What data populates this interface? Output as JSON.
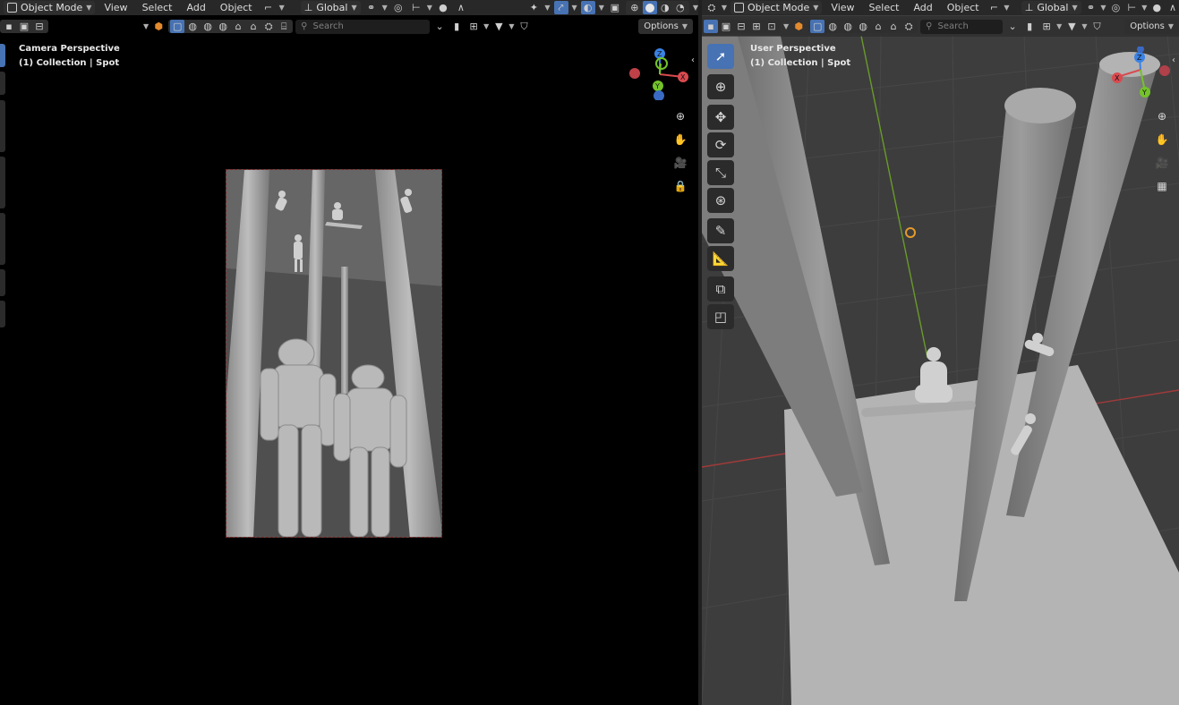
{
  "left_view": {
    "header": {
      "mode": "Object Mode",
      "menus": [
        "View",
        "Select",
        "Add",
        "Object"
      ],
      "orientation": "Global"
    },
    "subheader": {
      "search_placeholder": "Search",
      "options": "Options"
    },
    "overlay": {
      "view_name": "Camera Perspective",
      "collection": "(1) Collection | Spot"
    },
    "gizmo": {
      "x": "X",
      "y": "Y",
      "z": "Z"
    }
  },
  "right_view": {
    "header": {
      "mode": "Object Mode",
      "menus": [
        "View",
        "Select",
        "Add",
        "Object"
      ],
      "orientation": "Global"
    },
    "subheader": {
      "search_placeholder": "Search",
      "options": "Options"
    },
    "overlay": {
      "view_name": "User Perspective",
      "collection": "(1) Collection | Spot"
    },
    "gizmo": {
      "x": "X",
      "y": "Y",
      "z": "Z"
    },
    "tools": [
      "select-box",
      "cursor",
      "move",
      "rotate",
      "scale",
      "transform",
      "annotate",
      "measure",
      "add-cube",
      "extrude"
    ]
  },
  "colors": {
    "accent": "#4772b3",
    "axis_x": "#d94a4f",
    "axis_y": "#74c32a",
    "axis_z": "#3a82e4",
    "viewport_grid": "#3d3d3d",
    "camera_background": "#000000"
  }
}
